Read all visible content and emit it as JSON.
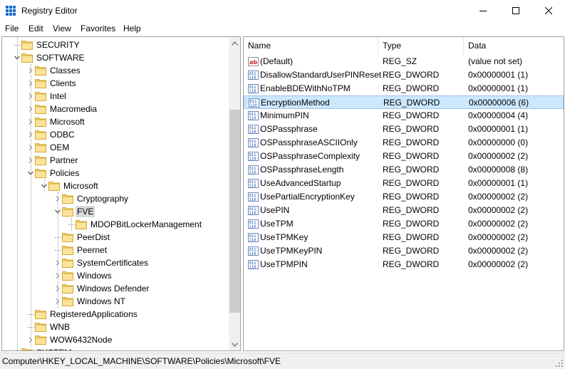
{
  "window": {
    "title": "Registry Editor",
    "icon": "registry-editor-icon"
  },
  "menu": [
    "File",
    "Edit",
    "View",
    "Favorites",
    "Help"
  ],
  "tree": [
    {
      "label": "SECURITY",
      "depth": 2,
      "expander": "none"
    },
    {
      "label": "SOFTWARE",
      "depth": 2,
      "expander": "expanded"
    },
    {
      "label": "Classes",
      "depth": 3,
      "expander": "collapsed"
    },
    {
      "label": "Clients",
      "depth": 3,
      "expander": "collapsed"
    },
    {
      "label": "Intel",
      "depth": 3,
      "expander": "collapsed"
    },
    {
      "label": "Macromedia",
      "depth": 3,
      "expander": "collapsed"
    },
    {
      "label": "Microsoft",
      "depth": 3,
      "expander": "collapsed"
    },
    {
      "label": "ODBC",
      "depth": 3,
      "expander": "collapsed"
    },
    {
      "label": "OEM",
      "depth": 3,
      "expander": "collapsed"
    },
    {
      "label": "Partner",
      "depth": 3,
      "expander": "collapsed"
    },
    {
      "label": "Policies",
      "depth": 3,
      "expander": "expanded"
    },
    {
      "label": "Microsoft",
      "depth": 4,
      "expander": "expanded"
    },
    {
      "label": "Cryptography",
      "depth": 5,
      "expander": "collapsed"
    },
    {
      "label": "FVE",
      "depth": 5,
      "expander": "expanded",
      "selected": true
    },
    {
      "label": "MDOPBitLockerManagement",
      "depth": 6,
      "expander": "none"
    },
    {
      "label": "PeerDist",
      "depth": 5,
      "expander": "none"
    },
    {
      "label": "Peernet",
      "depth": 5,
      "expander": "none"
    },
    {
      "label": "SystemCertificates",
      "depth": 5,
      "expander": "collapsed"
    },
    {
      "label": "Windows",
      "depth": 5,
      "expander": "collapsed"
    },
    {
      "label": "Windows Defender",
      "depth": 5,
      "expander": "collapsed"
    },
    {
      "label": "Windows NT",
      "depth": 5,
      "expander": "collapsed"
    },
    {
      "label": "RegisteredApplications",
      "depth": 3,
      "expander": "none"
    },
    {
      "label": "WNB",
      "depth": 3,
      "expander": "none"
    },
    {
      "label": "WOW6432Node",
      "depth": 3,
      "expander": "collapsed"
    },
    {
      "label": "SYSTEM",
      "depth": 2,
      "expander": "collapsed"
    }
  ],
  "list": {
    "headers": [
      "Name",
      "Type",
      "Data"
    ],
    "rows": [
      {
        "name": "(Default)",
        "type": "REG_SZ",
        "data": "(value not set)",
        "icon": "string-value-icon"
      },
      {
        "name": "DisallowStandardUserPINReset",
        "type": "REG_DWORD",
        "data": "0x00000001 (1)",
        "icon": "binary-value-icon"
      },
      {
        "name": "EnableBDEWithNoTPM",
        "type": "REG_DWORD",
        "data": "0x00000001 (1)",
        "icon": "binary-value-icon"
      },
      {
        "name": "EncryptionMethod",
        "type": "REG_DWORD",
        "data": "0x00000006 (6)",
        "icon": "binary-value-icon",
        "selected": true
      },
      {
        "name": "MinimumPIN",
        "type": "REG_DWORD",
        "data": "0x00000004 (4)",
        "icon": "binary-value-icon"
      },
      {
        "name": "OSPassphrase",
        "type": "REG_DWORD",
        "data": "0x00000001 (1)",
        "icon": "binary-value-icon"
      },
      {
        "name": "OSPassphraseASCIIOnly",
        "type": "REG_DWORD",
        "data": "0x00000000 (0)",
        "icon": "binary-value-icon"
      },
      {
        "name": "OSPassphraseComplexity",
        "type": "REG_DWORD",
        "data": "0x00000002 (2)",
        "icon": "binary-value-icon"
      },
      {
        "name": "OSPassphraseLength",
        "type": "REG_DWORD",
        "data": "0x00000008 (8)",
        "icon": "binary-value-icon"
      },
      {
        "name": "UseAdvancedStartup",
        "type": "REG_DWORD",
        "data": "0x00000001 (1)",
        "icon": "binary-value-icon"
      },
      {
        "name": "UsePartialEncryptionKey",
        "type": "REG_DWORD",
        "data": "0x00000002 (2)",
        "icon": "binary-value-icon"
      },
      {
        "name": "UsePIN",
        "type": "REG_DWORD",
        "data": "0x00000002 (2)",
        "icon": "binary-value-icon"
      },
      {
        "name": "UseTPM",
        "type": "REG_DWORD",
        "data": "0x00000002 (2)",
        "icon": "binary-value-icon"
      },
      {
        "name": "UseTPMKey",
        "type": "REG_DWORD",
        "data": "0x00000002 (2)",
        "icon": "binary-value-icon"
      },
      {
        "name": "UseTPMKeyPIN",
        "type": "REG_DWORD",
        "data": "0x00000002 (2)",
        "icon": "binary-value-icon"
      },
      {
        "name": "UseTPMPIN",
        "type": "REG_DWORD",
        "data": "0x00000002 (2)",
        "icon": "binary-value-icon"
      }
    ]
  },
  "status": {
    "path": "Computer\\HKEY_LOCAL_MACHINE\\SOFTWARE\\Policies\\Microsoft\\FVE"
  },
  "colors": {
    "folder": "#f8d775",
    "selection": "#cce8ff",
    "tree_selection": "#d9d9d9"
  }
}
